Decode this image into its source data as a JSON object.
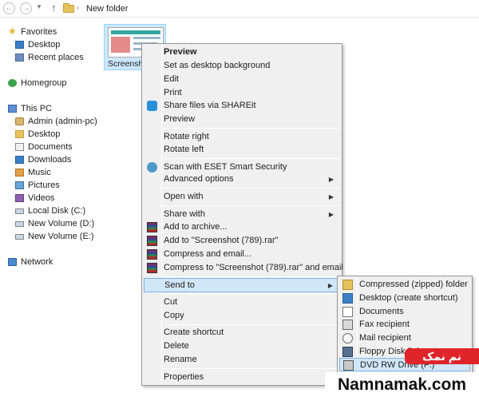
{
  "addressbar": {
    "back": "←",
    "forward": "→",
    "up": "↑",
    "separator": "›",
    "path": "New folder"
  },
  "nav": {
    "favorites": "Favorites",
    "desktop": "Desktop",
    "recent": "Recent places",
    "homegroup": "Homegroup",
    "thispc": "This PC",
    "admin": "Admin (admin-pc)",
    "desktop2": "Desktop",
    "documents": "Documents",
    "downloads": "Downloads",
    "music": "Music",
    "pictures": "Pictures",
    "videos": "Videos",
    "diskc": "Local Disk (C:)",
    "diskd": "New Volume (D:)",
    "diske": "New Volume (E:)",
    "network": "Network"
  },
  "file": {
    "name": "Screenshot"
  },
  "menu": {
    "items": [
      "Preview",
      "Set as desktop background",
      "Edit",
      "Print",
      "Share files via SHAREit",
      "Preview",
      "Rotate right",
      "Rotate left",
      "Scan with ESET Smart Security",
      "Advanced options",
      "Open with",
      "Share with",
      "Add to archive...",
      "Add to \"Screenshot (789).rar\"",
      "Compress and email...",
      "Compress to \"Screenshot (789).rar\" and email",
      "Send to",
      "Cut",
      "Copy",
      "Create shortcut",
      "Delete",
      "Rename",
      "Properties"
    ]
  },
  "sendto": {
    "items": [
      "Compressed (zipped) folder",
      "Desktop (create shortcut)",
      "Documents",
      "Fax recipient",
      "Mail recipient",
      "Floppy Disk Drive",
      "DVD RW Drive (F:)"
    ]
  },
  "watermark": {
    "badge": "نم نمک",
    "site": "Namnamak.com"
  },
  "colors": {
    "selection": "#cce8ff",
    "menu_highlight": "#d1e6f7",
    "watermark_red": "#e0252a"
  }
}
